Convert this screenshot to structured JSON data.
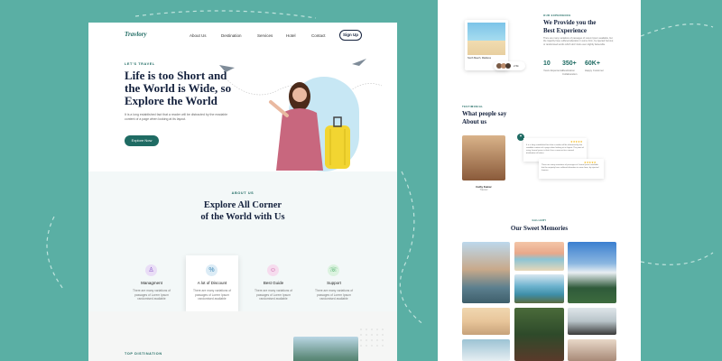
{
  "brand": {
    "name": "Travlory"
  },
  "nav": {
    "items": [
      "About Us",
      "Destination",
      "Services",
      "Hotel",
      "Contact"
    ],
    "signup": "Sign Up"
  },
  "hero": {
    "eyebrow": "LET'S TRAVEL",
    "title_lines": [
      "Life is too Short and",
      "the World is Wide, so",
      "Explore the World"
    ],
    "paragraph": "It is a long established fact that a reader will be distracted by the readable content of a page when looking at its layout.",
    "button": "Explore Now"
  },
  "about": {
    "eyebrow": "ABOUT US",
    "title_lines": [
      "Explore All Corner",
      "of the World with Us"
    ],
    "cards": [
      {
        "title": "Managment",
        "text": "There are many variations of passages of Lorem Ipsum randomised available",
        "icon": "person-icon",
        "color": "#e9ddf6"
      },
      {
        "title": "A lot of Discount",
        "text": "There are many variations of passages of Lorem Ipsum randomised available",
        "icon": "discount-icon",
        "color": "#dcecf6"
      },
      {
        "title": "Best Guide",
        "text": "There are many variations of passages of Lorem Ipsum randomised available",
        "icon": "guide-icon",
        "color": "#f6dcee"
      },
      {
        "title": "Support",
        "text": "There are many variations of passages of Lorem Ipsum randomised available",
        "icon": "support-icon",
        "color": "#dcf3e0"
      }
    ]
  },
  "destination": {
    "eyebrow": "TOP DISTINATION"
  },
  "experience": {
    "eyebrow": "OUR EXPERIENCE",
    "title_lines": [
      "We Provide you the",
      "Best Experience"
    ],
    "paragraph": "There are many variations of passages of Lorem Ipsum available, but the majority have suffered alteration in some form, by injected humour, or randomised words which don't look even slightly believable.",
    "stats": [
      {
        "value": "10",
        "label": "Years Experience"
      },
      {
        "value": "350+",
        "label": "Destination Collaboration"
      },
      {
        "value": "60K+",
        "label": "Happy Customer"
      }
    ],
    "card_caption": "North Beach, Maldives",
    "avatar_count": "2.5k"
  },
  "testimonial": {
    "eyebrow": "TESTIMONIAL",
    "title_lines": [
      "What people say",
      "About us"
    ],
    "quote": "It is a long established fact that a reader will be distracted by the readable content of a page when looking at its layout. The point of using Lorem Ipsum is that it has a more-or-less normal distribution of letters.",
    "quote2": "There are many variations of passages of Lorem Ipsum available but the majority have suffered alteration in some form, by injected humour.",
    "name": "Cathy Kumar",
    "role": "Traveler",
    "stars": "★★★★★"
  },
  "gallery": {
    "eyebrow": "GALLERY",
    "title": "Our Sweet Memories"
  },
  "colors": {
    "accent": "#1f6b63",
    "background": "#5aafa4",
    "heading": "#14213d"
  }
}
